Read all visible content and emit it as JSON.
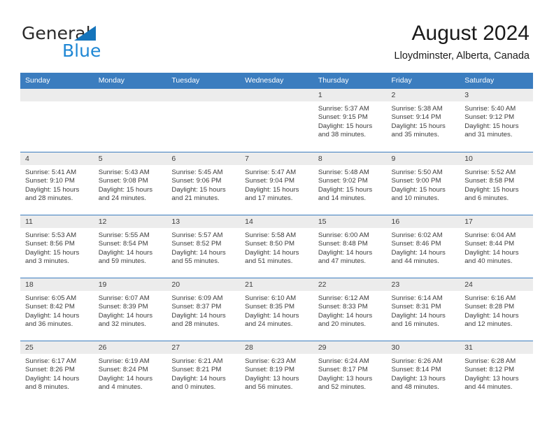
{
  "brand": {
    "name_part1": "General",
    "name_part2": "Blue",
    "triangle_color": "#1574bb",
    "blue_color": "#1f87d4"
  },
  "header": {
    "title": "August 2024",
    "subtitle": "Lloydminster, Alberta, Canada"
  },
  "theme": {
    "header_blue": "#3b7dbf",
    "daynum_gray": "#ececec",
    "text": "#3c3c3c"
  },
  "weekday_headers": [
    "Sunday",
    "Monday",
    "Tuesday",
    "Wednesday",
    "Thursday",
    "Friday",
    "Saturday"
  ],
  "weeks": [
    [
      {
        "day": "",
        "sunrise": "",
        "sunset": "",
        "daylight1": "",
        "daylight2": ""
      },
      {
        "day": "",
        "sunrise": "",
        "sunset": "",
        "daylight1": "",
        "daylight2": ""
      },
      {
        "day": "",
        "sunrise": "",
        "sunset": "",
        "daylight1": "",
        "daylight2": ""
      },
      {
        "day": "",
        "sunrise": "",
        "sunset": "",
        "daylight1": "",
        "daylight2": ""
      },
      {
        "day": "1",
        "sunrise": "Sunrise: 5:37 AM",
        "sunset": "Sunset: 9:15 PM",
        "daylight1": "Daylight: 15 hours",
        "daylight2": "and 38 minutes."
      },
      {
        "day": "2",
        "sunrise": "Sunrise: 5:38 AM",
        "sunset": "Sunset: 9:14 PM",
        "daylight1": "Daylight: 15 hours",
        "daylight2": "and 35 minutes."
      },
      {
        "day": "3",
        "sunrise": "Sunrise: 5:40 AM",
        "sunset": "Sunset: 9:12 PM",
        "daylight1": "Daylight: 15 hours",
        "daylight2": "and 31 minutes."
      }
    ],
    [
      {
        "day": "4",
        "sunrise": "Sunrise: 5:41 AM",
        "sunset": "Sunset: 9:10 PM",
        "daylight1": "Daylight: 15 hours",
        "daylight2": "and 28 minutes."
      },
      {
        "day": "5",
        "sunrise": "Sunrise: 5:43 AM",
        "sunset": "Sunset: 9:08 PM",
        "daylight1": "Daylight: 15 hours",
        "daylight2": "and 24 minutes."
      },
      {
        "day": "6",
        "sunrise": "Sunrise: 5:45 AM",
        "sunset": "Sunset: 9:06 PM",
        "daylight1": "Daylight: 15 hours",
        "daylight2": "and 21 minutes."
      },
      {
        "day": "7",
        "sunrise": "Sunrise: 5:47 AM",
        "sunset": "Sunset: 9:04 PM",
        "daylight1": "Daylight: 15 hours",
        "daylight2": "and 17 minutes."
      },
      {
        "day": "8",
        "sunrise": "Sunrise: 5:48 AM",
        "sunset": "Sunset: 9:02 PM",
        "daylight1": "Daylight: 15 hours",
        "daylight2": "and 14 minutes."
      },
      {
        "day": "9",
        "sunrise": "Sunrise: 5:50 AM",
        "sunset": "Sunset: 9:00 PM",
        "daylight1": "Daylight: 15 hours",
        "daylight2": "and 10 minutes."
      },
      {
        "day": "10",
        "sunrise": "Sunrise: 5:52 AM",
        "sunset": "Sunset: 8:58 PM",
        "daylight1": "Daylight: 15 hours",
        "daylight2": "and 6 minutes."
      }
    ],
    [
      {
        "day": "11",
        "sunrise": "Sunrise: 5:53 AM",
        "sunset": "Sunset: 8:56 PM",
        "daylight1": "Daylight: 15 hours",
        "daylight2": "and 3 minutes."
      },
      {
        "day": "12",
        "sunrise": "Sunrise: 5:55 AM",
        "sunset": "Sunset: 8:54 PM",
        "daylight1": "Daylight: 14 hours",
        "daylight2": "and 59 minutes."
      },
      {
        "day": "13",
        "sunrise": "Sunrise: 5:57 AM",
        "sunset": "Sunset: 8:52 PM",
        "daylight1": "Daylight: 14 hours",
        "daylight2": "and 55 minutes."
      },
      {
        "day": "14",
        "sunrise": "Sunrise: 5:58 AM",
        "sunset": "Sunset: 8:50 PM",
        "daylight1": "Daylight: 14 hours",
        "daylight2": "and 51 minutes."
      },
      {
        "day": "15",
        "sunrise": "Sunrise: 6:00 AM",
        "sunset": "Sunset: 8:48 PM",
        "daylight1": "Daylight: 14 hours",
        "daylight2": "and 47 minutes."
      },
      {
        "day": "16",
        "sunrise": "Sunrise: 6:02 AM",
        "sunset": "Sunset: 8:46 PM",
        "daylight1": "Daylight: 14 hours",
        "daylight2": "and 44 minutes."
      },
      {
        "day": "17",
        "sunrise": "Sunrise: 6:04 AM",
        "sunset": "Sunset: 8:44 PM",
        "daylight1": "Daylight: 14 hours",
        "daylight2": "and 40 minutes."
      }
    ],
    [
      {
        "day": "18",
        "sunrise": "Sunrise: 6:05 AM",
        "sunset": "Sunset: 8:42 PM",
        "daylight1": "Daylight: 14 hours",
        "daylight2": "and 36 minutes."
      },
      {
        "day": "19",
        "sunrise": "Sunrise: 6:07 AM",
        "sunset": "Sunset: 8:39 PM",
        "daylight1": "Daylight: 14 hours",
        "daylight2": "and 32 minutes."
      },
      {
        "day": "20",
        "sunrise": "Sunrise: 6:09 AM",
        "sunset": "Sunset: 8:37 PM",
        "daylight1": "Daylight: 14 hours",
        "daylight2": "and 28 minutes."
      },
      {
        "day": "21",
        "sunrise": "Sunrise: 6:10 AM",
        "sunset": "Sunset: 8:35 PM",
        "daylight1": "Daylight: 14 hours",
        "daylight2": "and 24 minutes."
      },
      {
        "day": "22",
        "sunrise": "Sunrise: 6:12 AM",
        "sunset": "Sunset: 8:33 PM",
        "daylight1": "Daylight: 14 hours",
        "daylight2": "and 20 minutes."
      },
      {
        "day": "23",
        "sunrise": "Sunrise: 6:14 AM",
        "sunset": "Sunset: 8:31 PM",
        "daylight1": "Daylight: 14 hours",
        "daylight2": "and 16 minutes."
      },
      {
        "day": "24",
        "sunrise": "Sunrise: 6:16 AM",
        "sunset": "Sunset: 8:28 PM",
        "daylight1": "Daylight: 14 hours",
        "daylight2": "and 12 minutes."
      }
    ],
    [
      {
        "day": "25",
        "sunrise": "Sunrise: 6:17 AM",
        "sunset": "Sunset: 8:26 PM",
        "daylight1": "Daylight: 14 hours",
        "daylight2": "and 8 minutes."
      },
      {
        "day": "26",
        "sunrise": "Sunrise: 6:19 AM",
        "sunset": "Sunset: 8:24 PM",
        "daylight1": "Daylight: 14 hours",
        "daylight2": "and 4 minutes."
      },
      {
        "day": "27",
        "sunrise": "Sunrise: 6:21 AM",
        "sunset": "Sunset: 8:21 PM",
        "daylight1": "Daylight: 14 hours",
        "daylight2": "and 0 minutes."
      },
      {
        "day": "28",
        "sunrise": "Sunrise: 6:23 AM",
        "sunset": "Sunset: 8:19 PM",
        "daylight1": "Daylight: 13 hours",
        "daylight2": "and 56 minutes."
      },
      {
        "day": "29",
        "sunrise": "Sunrise: 6:24 AM",
        "sunset": "Sunset: 8:17 PM",
        "daylight1": "Daylight: 13 hours",
        "daylight2": "and 52 minutes."
      },
      {
        "day": "30",
        "sunrise": "Sunrise: 6:26 AM",
        "sunset": "Sunset: 8:14 PM",
        "daylight1": "Daylight: 13 hours",
        "daylight2": "and 48 minutes."
      },
      {
        "day": "31",
        "sunrise": "Sunrise: 6:28 AM",
        "sunset": "Sunset: 8:12 PM",
        "daylight1": "Daylight: 13 hours",
        "daylight2": "and 44 minutes."
      }
    ]
  ]
}
